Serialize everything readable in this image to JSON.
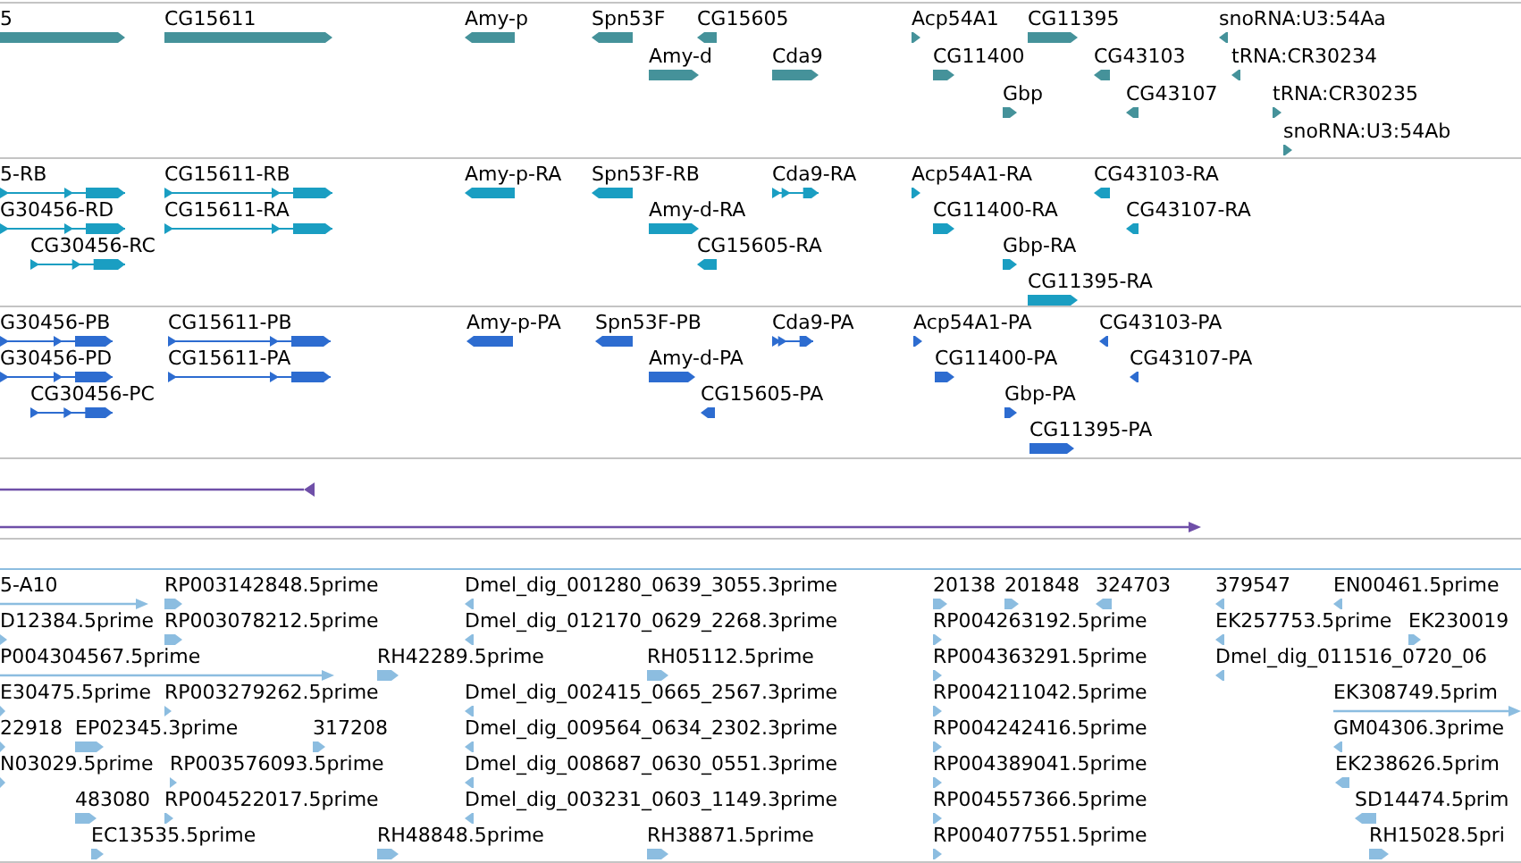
{
  "tracks": [
    {
      "kind": "gene",
      "rows": [
        {
          "features": [
            {
              "label": "5",
              "reverse": false
            },
            {
              "label": "CG15611",
              "reverse": false
            },
            {
              "label": "Amy-p",
              "reverse": true
            },
            {
              "label": "Spn53F",
              "reverse": true
            },
            {
              "label": "CG15605",
              "reverse": true
            },
            {
              "label": "Acp54A1",
              "reverse": false
            },
            {
              "label": "CG11395",
              "reverse": false
            },
            {
              "label": "snoRNA:U3:54Aa",
              "reverse": true
            }
          ]
        },
        {
          "features": [
            {
              "label": "Amy-d",
              "reverse": false
            },
            {
              "label": "Cda9",
              "reverse": false
            },
            {
              "label": "CG11400",
              "reverse": false
            },
            {
              "label": "CG43103",
              "reverse": true
            },
            {
              "label": "tRNA:CR30234",
              "reverse": true
            }
          ]
        },
        {
          "features": [
            {
              "label": "Gbp",
              "reverse": false
            },
            {
              "label": "CG43107",
              "reverse": true
            },
            {
              "label": "tRNA:CR30235",
              "reverse": false
            }
          ]
        },
        {
          "features": [
            {
              "label": "snoRNA:U3:54Ab",
              "reverse": false
            }
          ]
        }
      ]
    },
    {
      "kind": "transcript",
      "rows": [
        {
          "features": [
            {
              "label": "5-RB",
              "reverse": false
            },
            {
              "label": "CG15611-RB",
              "reverse": false
            },
            {
              "label": "Amy-p-RA",
              "reverse": true
            },
            {
              "label": "Spn53F-RB",
              "reverse": true
            },
            {
              "label": "Cda9-RA",
              "reverse": false
            },
            {
              "label": "Acp54A1-RA",
              "reverse": false
            },
            {
              "label": "CG43103-RA",
              "reverse": true
            }
          ]
        },
        {
          "features": [
            {
              "label": "G30456-RD",
              "reverse": false
            },
            {
              "label": "CG15611-RA",
              "reverse": false
            },
            {
              "label": "Amy-d-RA",
              "reverse": false
            },
            {
              "label": "CG11400-RA",
              "reverse": false
            },
            {
              "label": "CG43107-RA",
              "reverse": true
            }
          ]
        },
        {
          "features": [
            {
              "label": "CG30456-RC",
              "reverse": false
            },
            {
              "label": "CG15605-RA",
              "reverse": true
            },
            {
              "label": "Gbp-RA",
              "reverse": false
            }
          ]
        },
        {
          "features": [
            {
              "label": "CG11395-RA",
              "reverse": false
            }
          ]
        }
      ]
    },
    {
      "kind": "protein",
      "rows": [
        {
          "features": [
            {
              "label": "G30456-PB",
              "reverse": false
            },
            {
              "label": "CG15611-PB",
              "reverse": false
            },
            {
              "label": "Amy-p-PA",
              "reverse": true
            },
            {
              "label": "Spn53F-PB",
              "reverse": true
            },
            {
              "label": "Cda9-PA",
              "reverse": false
            },
            {
              "label": "Acp54A1-PA",
              "reverse": false
            },
            {
              "label": "CG43103-PA",
              "reverse": true
            }
          ]
        },
        {
          "features": [
            {
              "label": "G30456-PD",
              "reverse": false
            },
            {
              "label": "CG15611-PA",
              "reverse": false
            },
            {
              "label": "Amy-d-PA",
              "reverse": false
            },
            {
              "label": "CG11400-PA",
              "reverse": false
            },
            {
              "label": "CG43107-PA",
              "reverse": true
            }
          ]
        },
        {
          "features": [
            {
              "label": "CG30456-PC",
              "reverse": false
            },
            {
              "label": "CG15605-PA",
              "reverse": true
            },
            {
              "label": "Gbp-PA",
              "reverse": false
            }
          ]
        },
        {
          "features": [
            {
              "label": "CG11395-PA",
              "reverse": false
            }
          ]
        }
      ]
    },
    {
      "kind": "span",
      "rows": [
        {
          "features": [
            {
              "reverse": true
            }
          ]
        },
        {
          "features": [
            {
              "reverse": false
            }
          ]
        }
      ]
    },
    {
      "kind": "est",
      "rows": [
        {
          "features": [
            {
              "label": "5-A10",
              "reverse": false
            },
            {
              "label": "RP003142848.5prime",
              "reverse": false
            },
            {
              "label": "Dmel_dig_001280_0639_3055.3prime",
              "reverse": true
            },
            {
              "label": "20138",
              "reverse": false
            },
            {
              "label": "201848",
              "reverse": false
            },
            {
              "label": "324703",
              "reverse": true
            },
            {
              "label": "379547",
              "reverse": true
            },
            {
              "label": "EN00461.5prime",
              "reverse": true
            }
          ]
        },
        {
          "features": [
            {
              "label": "D12384.5prime",
              "reverse": false
            },
            {
              "label": "RP003078212.5prime",
              "reverse": false
            },
            {
              "label": "Dmel_dig_012170_0629_2268.3prime",
              "reverse": true
            },
            {
              "label": "RP004263192.5prime",
              "reverse": false
            },
            {
              "label": "EK257753.5prime",
              "reverse": true
            },
            {
              "label": "EK230019",
              "reverse": false
            }
          ]
        },
        {
          "features": [
            {
              "label": "P004304567.5prime",
              "reverse": false
            },
            {
              "label": "RH42289.5prime",
              "reverse": false
            },
            {
              "label": "RH05112.5prime",
              "reverse": false
            },
            {
              "label": "RP004363291.5prime",
              "reverse": false
            },
            {
              "label": "Dmel_dig_011516_0720_06",
              "reverse": true
            }
          ]
        },
        {
          "features": [
            {
              "label": "E30475.5prime",
              "reverse": false
            },
            {
              "label": "RP003279262.5prime",
              "reverse": false
            },
            {
              "label": "Dmel_dig_002415_0665_2567.3prime",
              "reverse": true
            },
            {
              "label": "RP004211042.5prime",
              "reverse": false
            },
            {
              "label": "EK308749.5prim",
              "reverse": false
            }
          ]
        },
        {
          "features": [
            {
              "label": "22918",
              "reverse": false
            },
            {
              "label": "EP02345.3prime",
              "reverse": false
            },
            {
              "label": "317208",
              "reverse": false
            },
            {
              "label": "Dmel_dig_009564_0634_2302.3prime",
              "reverse": true
            },
            {
              "label": "RP004242416.5prime",
              "reverse": false
            },
            {
              "label": "GM04306.3prime",
              "reverse": true
            }
          ]
        },
        {
          "features": [
            {
              "label": "N03029.5prime",
              "reverse": false
            },
            {
              "label": "RP003576093.5prime",
              "reverse": false
            },
            {
              "label": "Dmel_dig_008687_0630_0551.3prime",
              "reverse": true
            },
            {
              "label": "RP004389041.5prime",
              "reverse": false
            },
            {
              "label": "EK238626.5prim",
              "reverse": true
            }
          ]
        },
        {
          "features": [
            {
              "label": "483080",
              "reverse": false
            },
            {
              "label": "RP004522017.5prime",
              "reverse": false
            },
            {
              "label": "Dmel_dig_003231_0603_1149.3prime",
              "reverse": true
            },
            {
              "label": "RP004557366.5prime",
              "reverse": false
            },
            {
              "label": "SD14474.5prim",
              "reverse": true
            }
          ]
        },
        {
          "features": [
            {
              "label": "EC13535.5prime",
              "reverse": false
            },
            {
              "label": "RH48848.5prime",
              "reverse": false
            },
            {
              "label": "RH38871.5prime",
              "reverse": false
            },
            {
              "label": "RP004077551.5prime",
              "reverse": false
            },
            {
              "label": "RH15028.5pri",
              "reverse": false
            }
          ]
        }
      ]
    }
  ]
}
